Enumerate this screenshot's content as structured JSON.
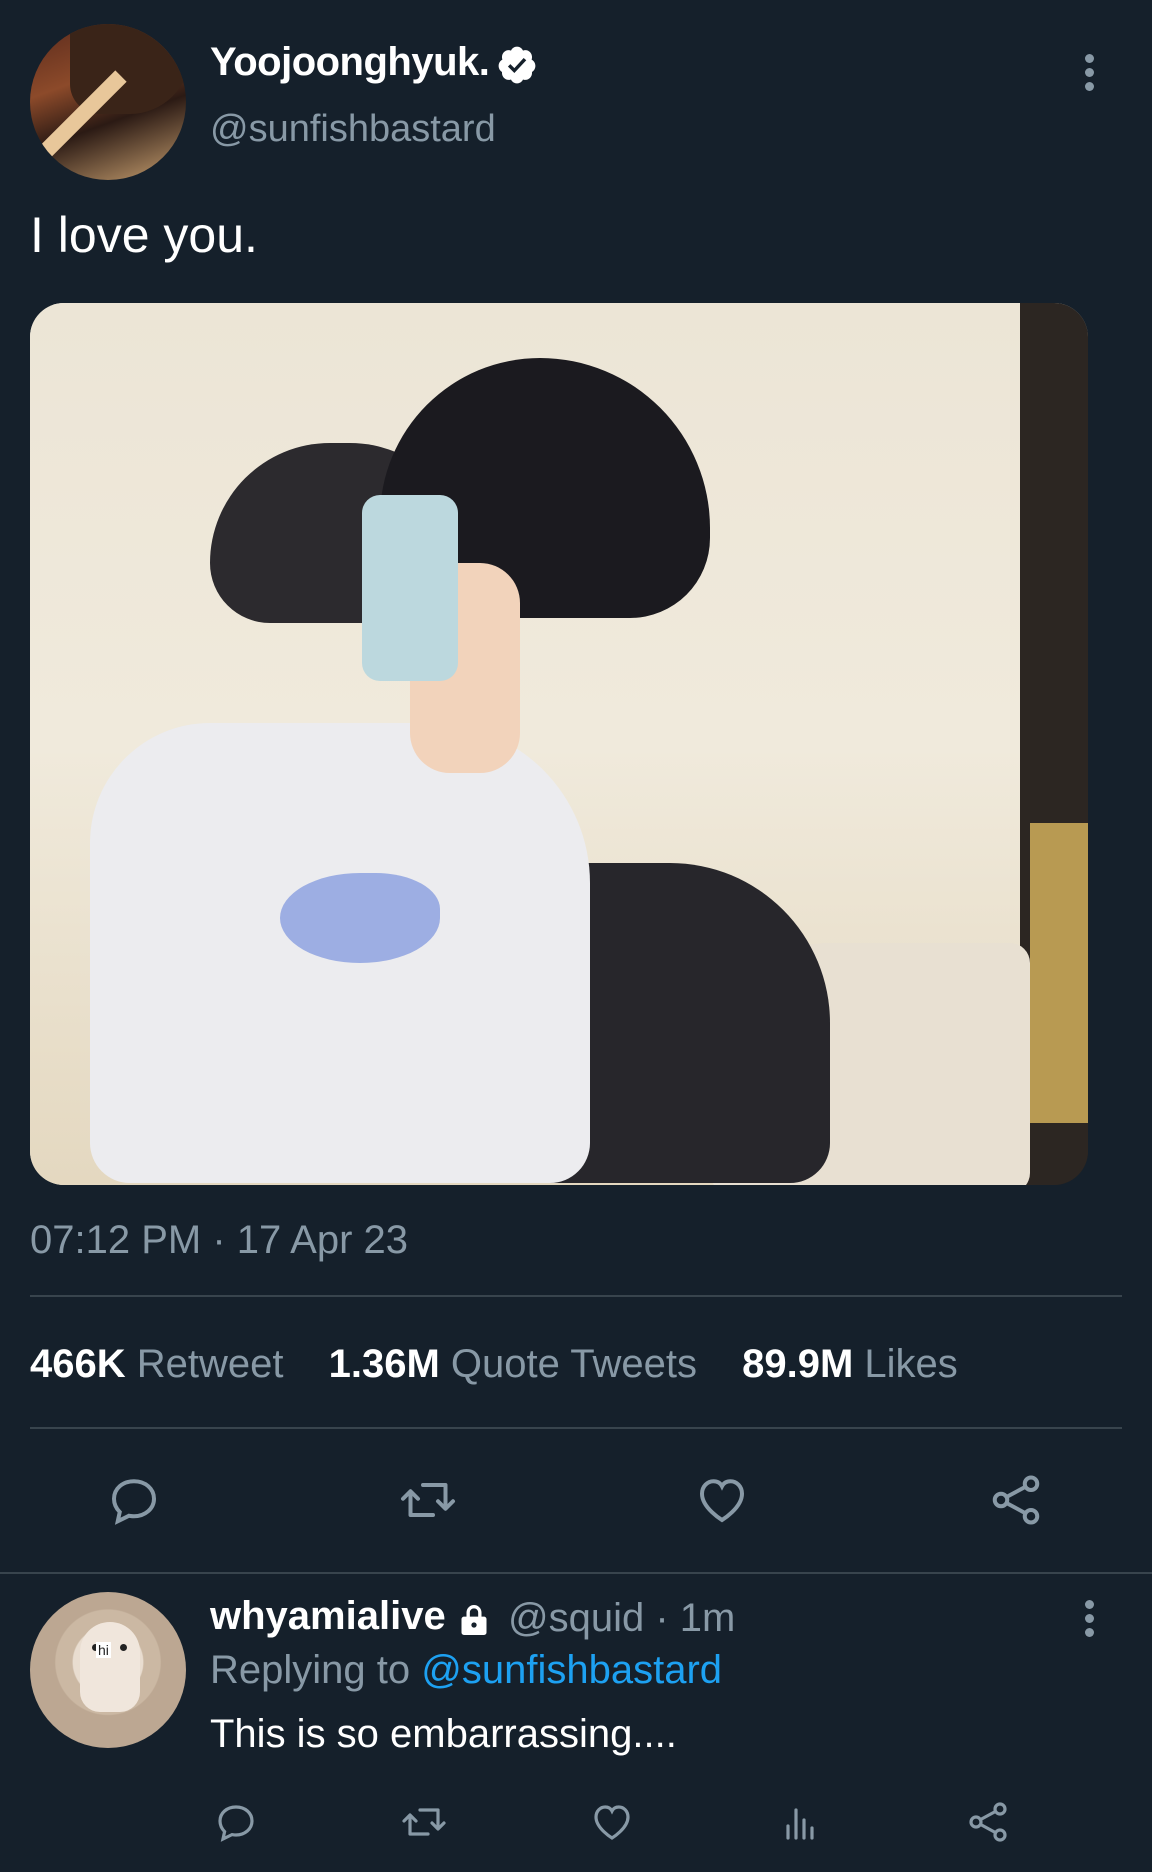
{
  "tweet": {
    "display_name": "Yoojoonghyuk.",
    "handle": "@sunfishbastard",
    "text": "I love you.",
    "timestamp": "07:12 PM · 17 Apr 23",
    "stats": {
      "retweets_count": "466K",
      "retweets_label": "Retweet",
      "quotes_count": "1.36M",
      "quotes_label": "Quote Tweets",
      "likes_count": "89.9M",
      "likes_label": "Likes"
    },
    "actions": [
      "reply-icon",
      "retweet-icon",
      "heart-icon",
      "share-icon"
    ]
  },
  "reply": {
    "display_name": "whyamialive",
    "meta": "@squid · 1m",
    "replying_prefix": "Replying to",
    "replying_to": "@sunfishbastard",
    "text": "This is so embarrassing....",
    "avatar_tag": "hi",
    "actions": [
      "reply-icon",
      "retweet-icon",
      "heart-icon",
      "analytics-icon",
      "share-icon"
    ]
  },
  "colors": {
    "background": "#15202b",
    "secondary_text": "#8899a6",
    "accent": "#1da1f2",
    "divider": "#38444d"
  }
}
